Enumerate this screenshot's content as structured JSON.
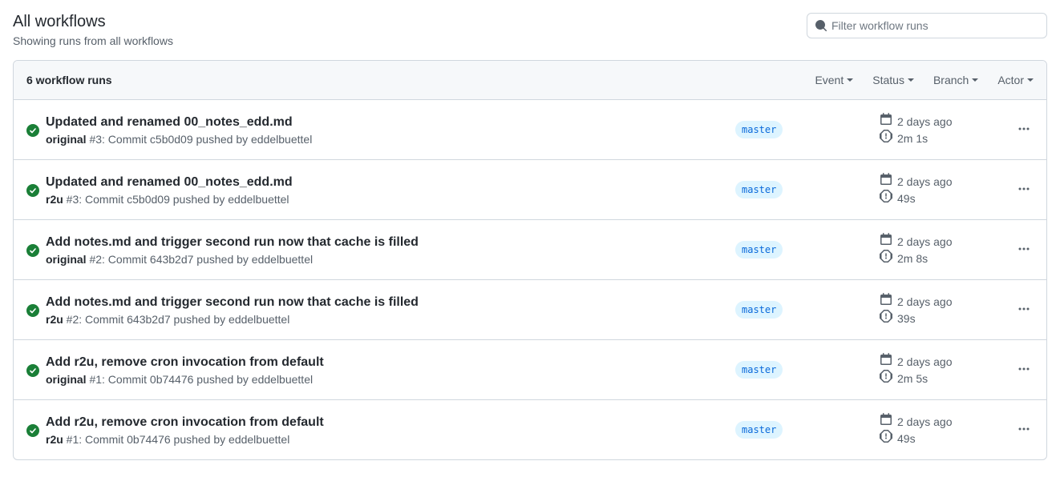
{
  "header": {
    "title": "All workflows",
    "subtitle": "Showing runs from all workflows"
  },
  "search": {
    "placeholder": "Filter workflow runs"
  },
  "box_header": {
    "count_label": "6 workflow runs"
  },
  "filters": {
    "event": "Event",
    "status": "Status",
    "branch": "Branch",
    "actor": "Actor"
  },
  "runs": [
    {
      "title": "Updated and renamed 00_notes_edd.md",
      "workflow": "original",
      "sub": " #3: Commit c5b0d09 pushed by eddelbuettel",
      "branch": "master",
      "time": "2 days ago",
      "duration": "2m 1s"
    },
    {
      "title": "Updated and renamed 00_notes_edd.md",
      "workflow": "r2u",
      "sub": " #3: Commit c5b0d09 pushed by eddelbuettel",
      "branch": "master",
      "time": "2 days ago",
      "duration": "49s"
    },
    {
      "title": "Add notes.md and trigger second run now that cache is filled",
      "workflow": "original",
      "sub": " #2: Commit 643b2d7 pushed by eddelbuettel",
      "branch": "master",
      "time": "2 days ago",
      "duration": "2m 8s"
    },
    {
      "title": "Add notes.md and trigger second run now that cache is filled",
      "workflow": "r2u",
      "sub": " #2: Commit 643b2d7 pushed by eddelbuettel",
      "branch": "master",
      "time": "2 days ago",
      "duration": "39s"
    },
    {
      "title": "Add r2u, remove cron invocation from default",
      "workflow": "original",
      "sub": " #1: Commit 0b74476 pushed by eddelbuettel",
      "branch": "master",
      "time": "2 days ago",
      "duration": "2m 5s"
    },
    {
      "title": "Add r2u, remove cron invocation from default",
      "workflow": "r2u",
      "sub": " #1: Commit 0b74476 pushed by eddelbuettel",
      "branch": "master",
      "time": "2 days ago",
      "duration": "49s"
    }
  ]
}
